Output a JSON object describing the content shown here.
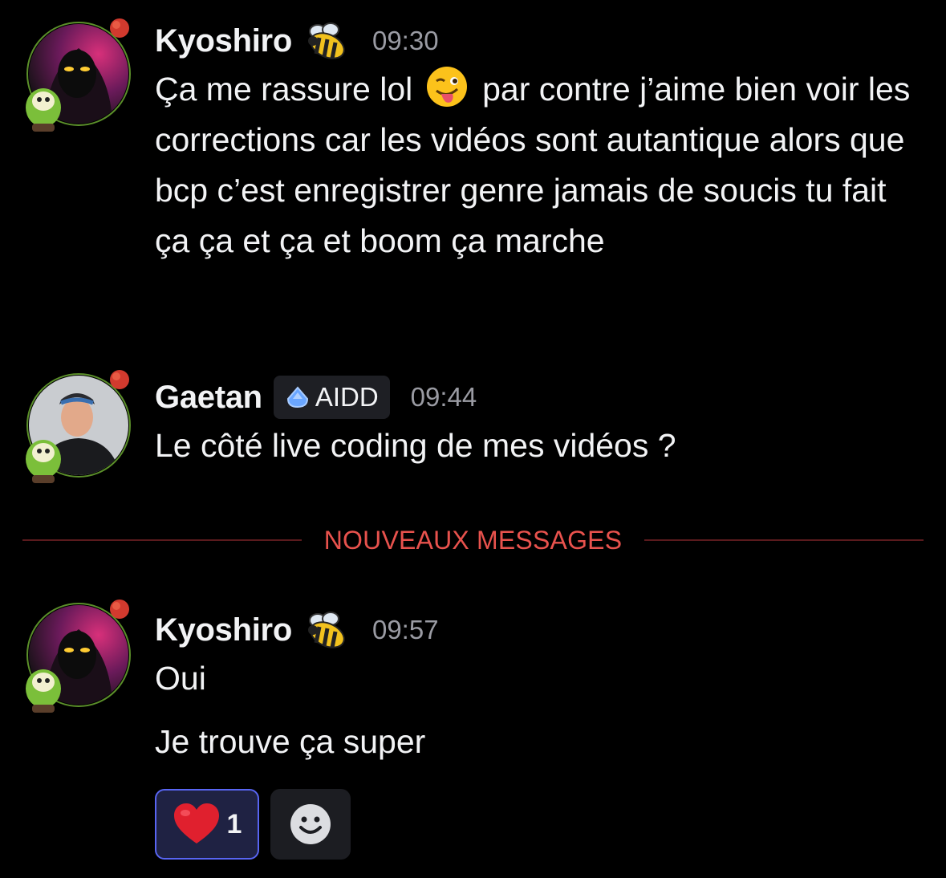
{
  "messages": [
    {
      "username": "Kyoshiro",
      "timestamp": "09:30",
      "text_before_emoji": "Ça me rassure lol",
      "text_after_emoji": "par contre j’aime bien voir les corrections car les vidéos sont autantique alors que bcp c’est enregistrer genre jamais de soucis tu fait ça ça et ça et boom ça marche"
    },
    {
      "username": "Gaetan",
      "role_badge": "AIDD",
      "timestamp": "09:44",
      "text": "Le côté live coding de mes vidéos ?"
    },
    {
      "username": "Kyoshiro",
      "timestamp": "09:57",
      "text_1": "Oui",
      "text_2": "Je trouve ça super"
    }
  ],
  "divider": {
    "label": "NOUVEAUX MESSAGES"
  },
  "reactions": [
    {
      "emoji": "heart-emoji",
      "count": "1",
      "selected": true
    }
  ],
  "colors": {
    "background": "#000000",
    "text": "#f2f3f5",
    "timestamp": "#9a9ba3",
    "new_messages": "#e8524d",
    "reaction_border": "#5865f2"
  }
}
